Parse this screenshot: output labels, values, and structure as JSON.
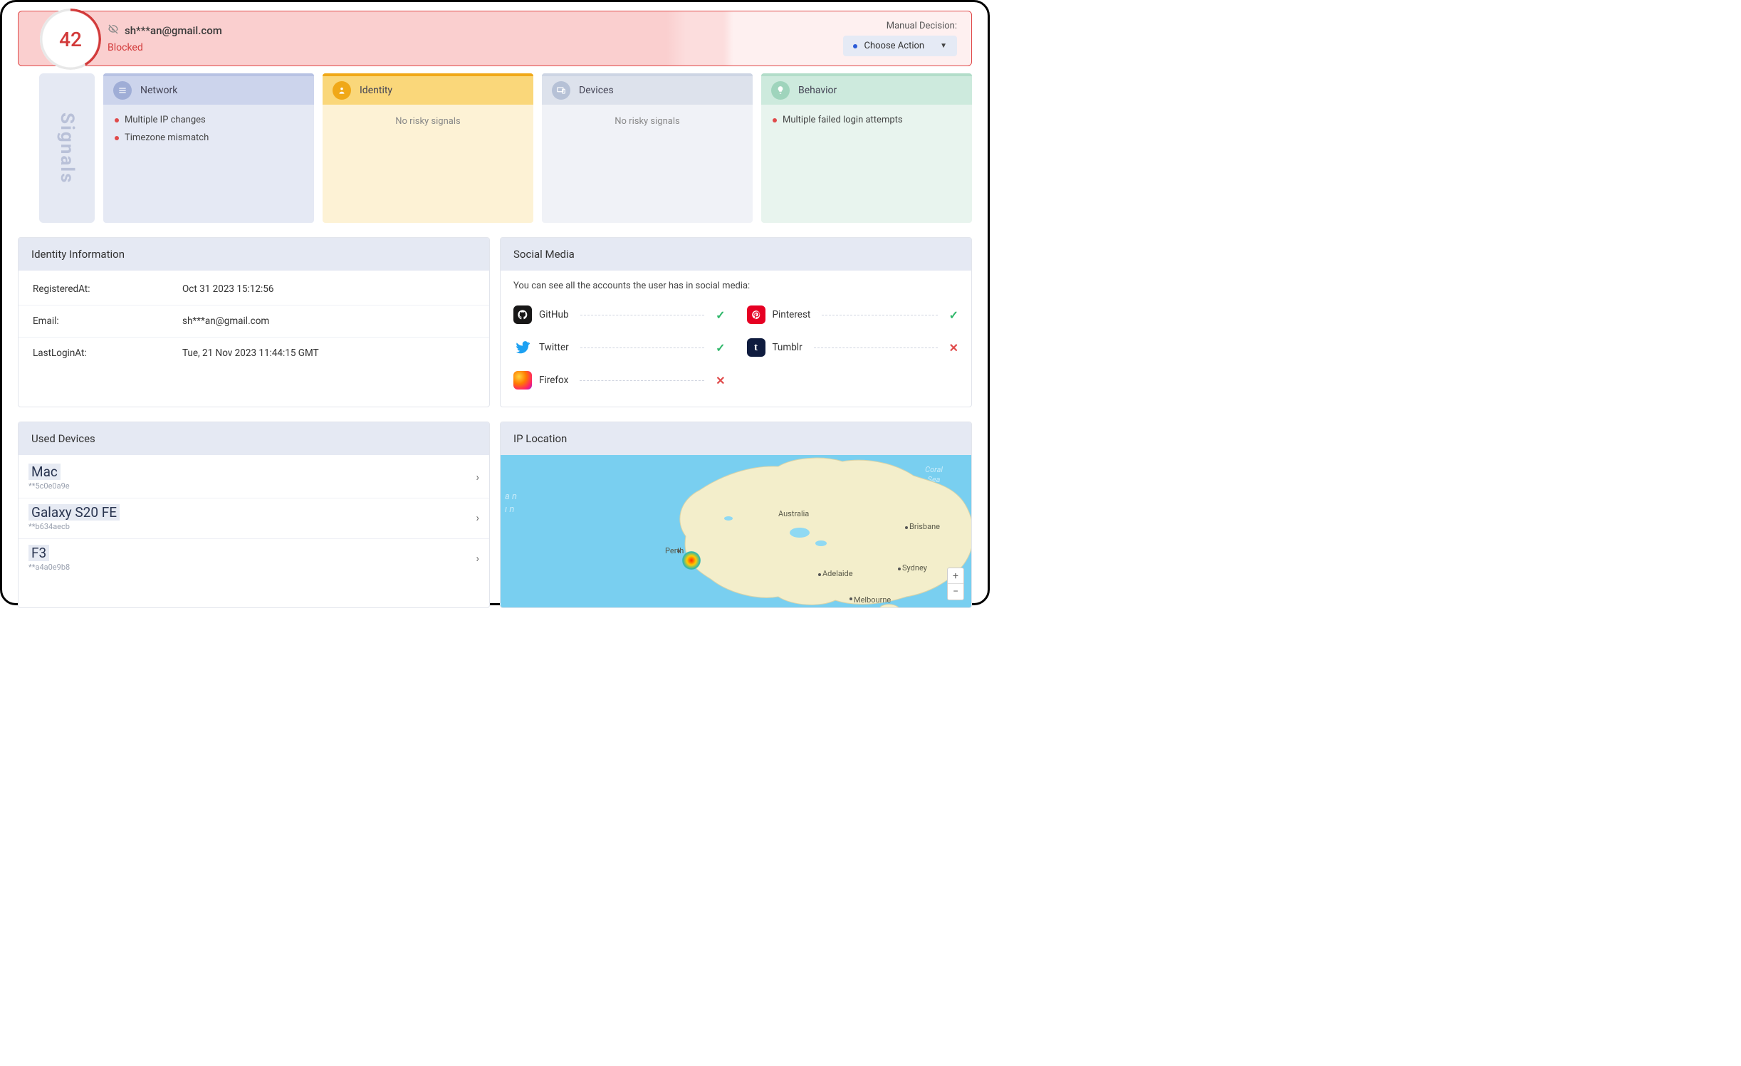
{
  "header": {
    "score": "42",
    "email": "sh***an@gmail.com",
    "status": "Blocked",
    "manual_label": "Manual Decision:",
    "action_label": "Choose Action"
  },
  "signals": {
    "title": "Signals",
    "categories": [
      {
        "key": "network",
        "label": "Network",
        "items": [
          "Multiple IP changes",
          "Timezone mismatch"
        ],
        "empty_text": ""
      },
      {
        "key": "identity",
        "label": "Identity",
        "items": [],
        "empty_text": "No risky signals"
      },
      {
        "key": "devices",
        "label": "Devices",
        "items": [],
        "empty_text": "No risky signals"
      },
      {
        "key": "behavior",
        "label": "Behavior",
        "items": [
          "Multiple failed login attempts"
        ],
        "empty_text": ""
      }
    ]
  },
  "identity_panel": {
    "title": "Identity Information",
    "rows": [
      {
        "k": "RegisteredAt:",
        "v": "Oct 31 2023 15:12:56"
      },
      {
        "k": "Email:",
        "v": "sh***an@gmail.com"
      },
      {
        "k": "LastLoginAt:",
        "v": "Tue, 21 Nov 2023 11:44:15 GMT"
      }
    ]
  },
  "social_panel": {
    "title": "Social Media",
    "intro": "You can see all the accounts the user has in social media:",
    "left": [
      {
        "name": "GitHub",
        "status": "ok",
        "brand_bg": "#181717"
      },
      {
        "name": "Twitter",
        "status": "ok",
        "brand_bg": "#1DA1F2"
      },
      {
        "name": "Firefox",
        "status": "no",
        "brand_bg": "linear-gradient(135deg,#ff9500,#ff3b6b)"
      }
    ],
    "right": [
      {
        "name": "Pinterest",
        "status": "ok",
        "brand_bg": "#E60023"
      },
      {
        "name": "Tumblr",
        "status": "no",
        "brand_bg": "#0f1c3f"
      }
    ]
  },
  "devices_panel": {
    "title": "Used Devices",
    "rows": [
      {
        "name": "Mac",
        "id": "**5c0e0a9e"
      },
      {
        "name": "Galaxy S20 FE",
        "id": "**b634aecb"
      },
      {
        "name": "F3",
        "id": "**a4a0e9b8"
      }
    ]
  },
  "iploc_panel": {
    "title": "IP Location",
    "country_label": "Australia",
    "cities": [
      "Perth",
      "Adelaide",
      "Melbourne",
      "Sydney",
      "Brisbane"
    ],
    "ocean": "Indian\nOcean",
    "sea": "Coral\nSea"
  }
}
